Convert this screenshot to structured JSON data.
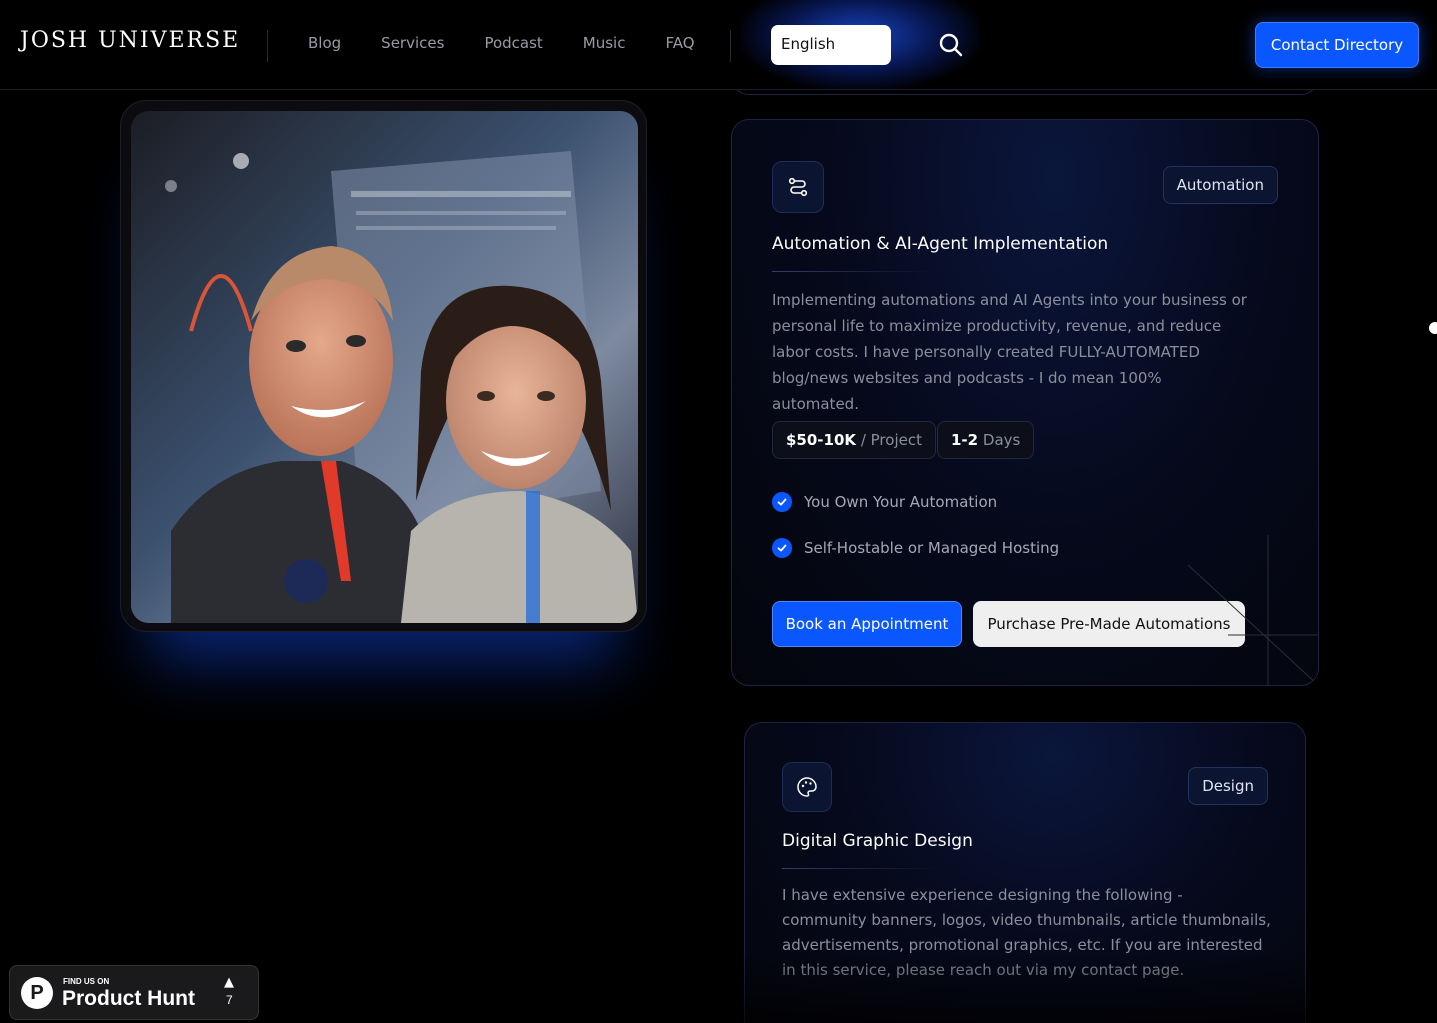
{
  "header": {
    "logo": "JOSH UNIVERSE",
    "nav": [
      "Blog",
      "Services",
      "Podcast",
      "Music",
      "FAQ"
    ],
    "language": "English",
    "contact_label": "Contact Directory"
  },
  "photo": {
    "icon": "photo-of-two-people"
  },
  "services": [
    {
      "icon": "route-icon",
      "tag": "Automation",
      "title": "Automation & AI-Agent Implementation",
      "description": "Implementing automations and AI Agents into your business or personal life to maximize productivity, revenue, and reduce labor costs. I have personally created FULLY-AUTOMATED blog/news websites and podcasts - I do mean 100% automated.",
      "price": "$50-10K",
      "price_unit": "/ Project",
      "duration": "1-2",
      "duration_unit": "Days",
      "features": [
        "You Own Your Automation",
        "Self-Hostable or Managed Hosting"
      ],
      "primary_button": "Book an Appointment",
      "secondary_button": "Purchase Pre-Made Automations"
    },
    {
      "icon": "palette-icon",
      "tag": "Design",
      "title": "Digital Graphic Design",
      "description": "I have extensive experience designing the following - community banners, logos, video thumbnails, article thumbnails, advertisements, promotional graphics, etc. If you are interested in this service, please reach out via my contact page."
    }
  ],
  "product_hunt": {
    "small": "FIND US ON",
    "big": "Product Hunt",
    "count": "7"
  }
}
